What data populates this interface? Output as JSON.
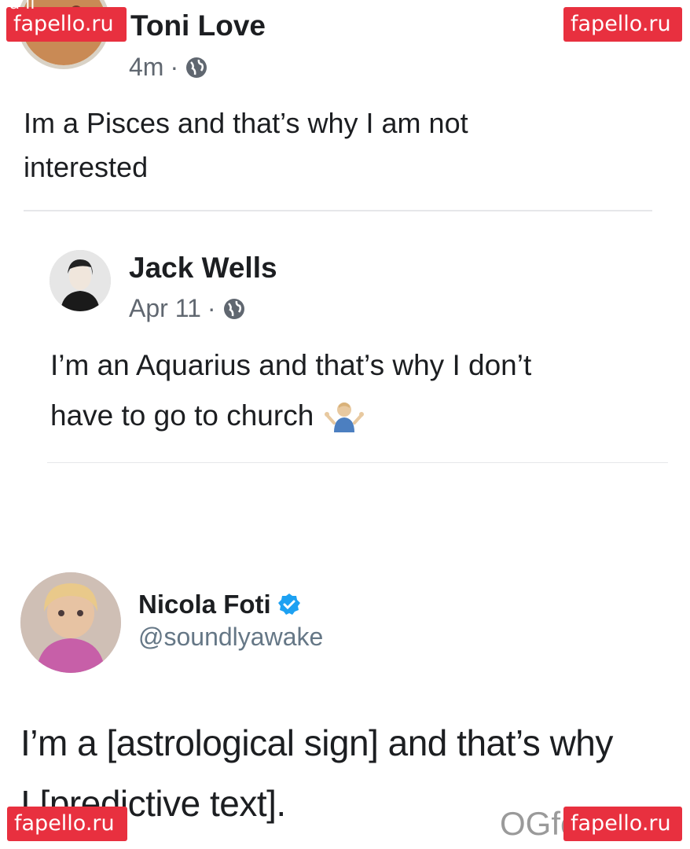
{
  "watermark": {
    "label": "fapello.ru",
    "top_left_partial": "fa    ll"
  },
  "posts": [
    {
      "author": "Toni Love",
      "time": "4m",
      "separator": "·",
      "text_lines": [
        "Im a Pisces and that’s why I am not",
        "interested"
      ]
    },
    {
      "author": "Jack Wells",
      "time": "Apr 11",
      "separator": "·",
      "text_lines": [
        "I’m an Aquarius and that’s why I don’t",
        "have to go to church"
      ]
    }
  ],
  "tweet": {
    "author": "Nicola Foti",
    "handle": "@soundlyawake",
    "text_lines": [
      "I’m a [astrological sign] and that’s why",
      "I [predictive text]."
    ]
  },
  "bottom_watermark_text": "OGfe",
  "colors": {
    "badge": "#e8303f",
    "verified": "#1da1f2",
    "meta": "#606770",
    "divider": "#e6e7ea"
  },
  "icons": [
    "globe-icon",
    "shrug-emoji-icon",
    "verified-badge-icon"
  ]
}
